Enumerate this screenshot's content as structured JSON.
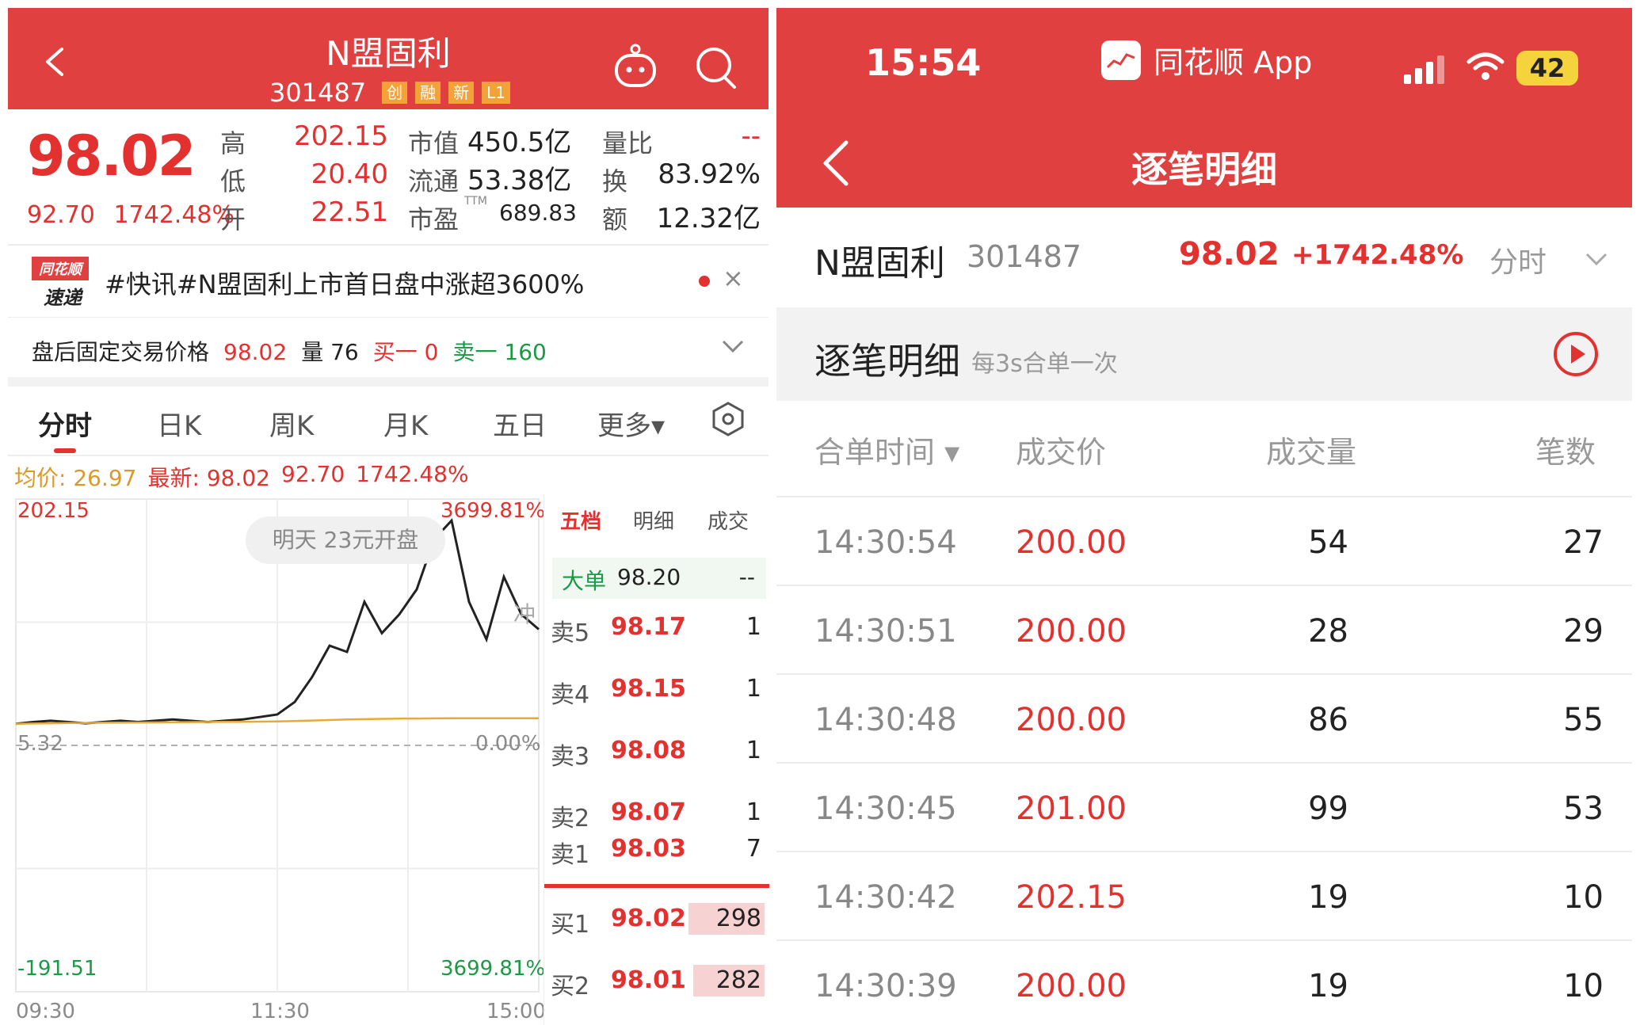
{
  "left": {
    "header": {
      "title": "N盟固利",
      "code": "301487",
      "tags": [
        "创",
        "融",
        "新",
        "L1"
      ]
    },
    "quote": {
      "price": "98.02",
      "change": "92.70",
      "change_pct": "1742.48%",
      "high_label": "高",
      "high": "202.15",
      "low_label": "低",
      "low": "20.40",
      "open_label": "开",
      "open": "22.51",
      "mcap_label": "市值",
      "mcap": "450.5亿",
      "float_label": "流通",
      "float": "53.38亿",
      "pe_label": "市盈",
      "pe_sup": "TTM",
      "pe": "689.83",
      "volratio_label": "量比",
      "volratio": "--",
      "turnover_label": "换",
      "turnover": "83.92%",
      "amount_label": "额",
      "amount": "12.32亿"
    },
    "news": {
      "logo_line1": "同花顺",
      "logo_line2": "速递",
      "text": "#快讯#N盟固利上市首日盘中涨超3600%",
      "close": "×"
    },
    "after_hours": {
      "label": "盘后固定交易价格",
      "price": "98.02",
      "vol_label": "量",
      "vol": "76",
      "bid_label": "买一",
      "bid": "0",
      "ask_label": "卖一",
      "ask": "160"
    },
    "tabs": [
      "分时",
      "日K",
      "周K",
      "月K",
      "五日",
      "更多▾"
    ],
    "avg_line": {
      "avg": "均价: 26.97",
      "latest": "最新: 98.02",
      "change": "92.70",
      "pct": "1742.48%"
    },
    "chart": {
      "top_left": "202.15",
      "top_right": "3699.81%",
      "mid_left": "5.32",
      "mid_right": "0.00%",
      "bottom_left": "-191.51",
      "bottom_right": "3699.81%",
      "open_hint": "明天 23元开盘",
      "chong": "冲",
      "times": [
        "09:30",
        "11:30",
        "15:00"
      ]
    },
    "depth": {
      "tabs": [
        "五档",
        "明细",
        "成交"
      ],
      "big_label": "大单",
      "big_price": "98.20",
      "big_vol": "--",
      "asks": [
        {
          "label": "卖5",
          "price": "98.17",
          "vol": "1"
        },
        {
          "label": "卖4",
          "price": "98.15",
          "vol": "1"
        },
        {
          "label": "卖3",
          "price": "98.08",
          "vol": "1"
        },
        {
          "label": "卖2",
          "price": "98.07",
          "vol": "1"
        },
        {
          "label": "卖1",
          "price": "98.03",
          "vol": "7"
        }
      ],
      "bids": [
        {
          "label": "买1",
          "price": "98.02",
          "vol": "298"
        },
        {
          "label": "买2",
          "price": "98.01",
          "vol": "282"
        }
      ]
    }
  },
  "right": {
    "status": {
      "time": "15:54",
      "app": "同花顺 App",
      "battery": "42"
    },
    "title": "逐笔明细",
    "stock": {
      "name": "N盟固利",
      "code": "301487",
      "price": "98.02",
      "pct": "+1742.48%",
      "period": "分时"
    },
    "section": {
      "title": "逐笔明细",
      "subtitle": "每3s合单一次"
    },
    "columns": [
      "合单时间 ▾",
      "成交价",
      "成交量",
      "笔数"
    ],
    "rows": [
      {
        "time": "14:30:54",
        "price": "200.00",
        "vol": "54",
        "count": "27"
      },
      {
        "time": "14:30:51",
        "price": "200.00",
        "vol": "28",
        "count": "29"
      },
      {
        "time": "14:30:48",
        "price": "200.00",
        "vol": "86",
        "count": "55"
      },
      {
        "time": "14:30:45",
        "price": "201.00",
        "vol": "99",
        "count": "53"
      },
      {
        "time": "14:30:42",
        "price": "202.15",
        "vol": "19",
        "count": "10"
      },
      {
        "time": "14:30:39",
        "price": "200.00",
        "vol": "19",
        "count": "10"
      }
    ]
  },
  "chart_data": {
    "type": "line",
    "x": [
      "09:30",
      "11:30",
      "15:00"
    ],
    "series": [
      {
        "values": [
          22.51,
          24,
          25,
          24,
          23,
          24,
          25,
          24,
          25,
          26,
          25,
          24,
          25,
          26,
          28,
          30,
          40,
          60,
          85,
          80,
          120,
          95,
          110,
          130,
          170,
          185,
          120,
          90,
          140,
          110,
          98.02
        ]
      },
      {
        "values": [
          22.51,
          22.8,
          23,
          23.2,
          23.3,
          23.4,
          23.5,
          23.6,
          23.7,
          23.8,
          23.9,
          24,
          24.1,
          24.2,
          24.3,
          24.5,
          24.8,
          25.2,
          25.6,
          26,
          26.3,
          26.5,
          26.7,
          26.8,
          26.9,
          26.95,
          26.97,
          26.97,
          26.97,
          26.97,
          26.97
        ]
      }
    ],
    "ylim": [
      -191.51,
      202.15
    ],
    "yticks_left": [
      "202.15",
      "5.32",
      "-191.51"
    ],
    "yticks_right": [
      "3699.81%",
      "0.00%",
      "3699.81%"
    ]
  }
}
